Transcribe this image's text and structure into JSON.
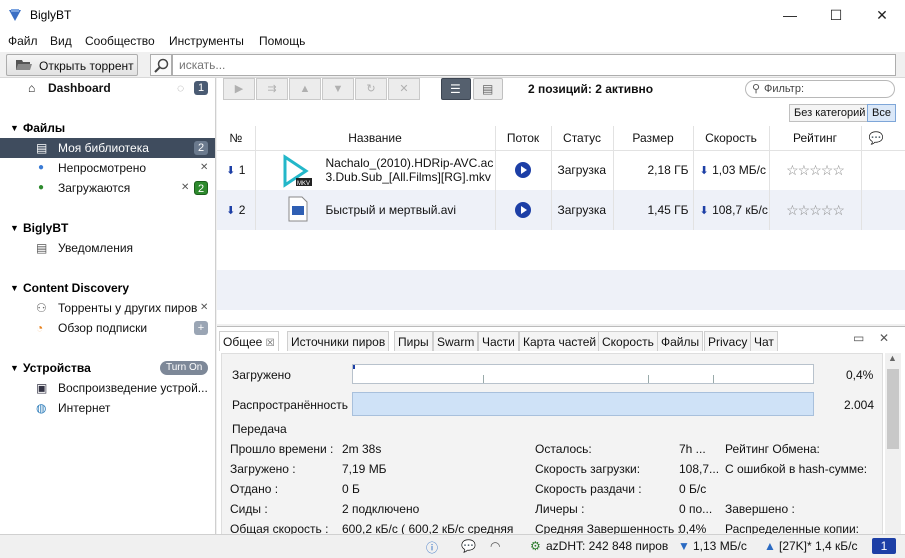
{
  "window": {
    "title": "BiglyBT",
    "minimize": "—",
    "maximize": "☐",
    "close": "✕"
  },
  "menu": [
    "Файл",
    "Вид",
    "Сообщество",
    "Инструменты",
    "Помощь"
  ],
  "toolbar": {
    "open_label": "Открыть торрент",
    "search_placeholder": "искать..."
  },
  "sidebar": {
    "dashboard": {
      "label": "Dashboard",
      "count": "1"
    },
    "files": {
      "header": "Файлы",
      "items": [
        {
          "label": "Моя библиотека",
          "count": "2"
        },
        {
          "label": "Непросмотрено"
        },
        {
          "label": "Загружаются",
          "count": "2"
        }
      ]
    },
    "biglybt": {
      "header": "BiglyBT",
      "items": [
        {
          "label": "Уведомления"
        }
      ]
    },
    "content_discovery": {
      "header": "Content Discovery",
      "items": [
        {
          "label": "Торренты у других пиров"
        },
        {
          "label": "Обзор подписки"
        }
      ]
    },
    "devices": {
      "header": "Устройства",
      "turn_on": "Turn On",
      "items": [
        {
          "label": "Воспроизведение устрой..."
        },
        {
          "label": "Интернет"
        }
      ]
    }
  },
  "list": {
    "summary": "2 позиций: 2 активно",
    "filter_placeholder": "Фильтр:",
    "categories": [
      "Без категорий",
      "Все"
    ],
    "columns": [
      "№",
      "Название",
      "Поток",
      "Статус",
      "Размер",
      "Скорость",
      "Рейтинг"
    ],
    "rows": [
      {
        "num": "1",
        "name": "Nachalo_(2010).HDRip-AVC.ac3.Dub.Sub_[All.Films][RG].mkv",
        "name_line1": "Nachalo_(2010).HDRip-AVC.ac",
        "name_line2": "3.Dub.Sub_[All.Films][RG].mkv",
        "status": "Загрузка",
        "size": "2,18 ГБ",
        "speed": "1,03 МБ/с",
        "icon_badge": "MKV"
      },
      {
        "num": "2",
        "name": "Быстрый и мертвый.avi",
        "status": "Загрузка",
        "size": "1,45 ГБ",
        "speed": "108,7 кБ/с"
      }
    ]
  },
  "detail": {
    "tabs": [
      "Общее",
      "Источники пиров",
      "Пиры",
      "Swarm",
      "Части",
      "Карта частей",
      "Скорость",
      "Файлы",
      "Privacy",
      "Чат"
    ],
    "downloaded_label": "Загружено",
    "downloaded_pct": "0,4%",
    "availability_label": "Распространённость",
    "availability_value": "2.004",
    "transfer_header": "Передача",
    "col1": [
      {
        "label": "Прошло времени :",
        "value": "2m 38s"
      },
      {
        "label": "Загружено :",
        "value": "7,19 МБ"
      },
      {
        "label": "Отдано :",
        "value": "0 Б"
      },
      {
        "label": "Сиды :",
        "value": "2 подключено"
      },
      {
        "label": "Общая скорость :",
        "value": "600,2 кБ/с ( 600,2 кБ/с средняя"
      }
    ],
    "col2": [
      {
        "label": "Осталось:",
        "value": "7h ..."
      },
      {
        "label": "Скорость загрузки:",
        "value": "108,7..."
      },
      {
        "label": "Скорость раздачи :",
        "value": "0 Б/с"
      },
      {
        "label": "Личеры :",
        "value": "0 по..."
      },
      {
        "label": "Средняя Завершенность :",
        "value": "0,4%"
      }
    ],
    "col3": [
      {
        "label": "Рейтинг Обмена:"
      },
      {
        "label": "С ошибкой в hash-сумме:"
      },
      {
        "label": ""
      },
      {
        "label": "Завершено :"
      },
      {
        "label": "Распределенные копии:"
      }
    ]
  },
  "status": {
    "dht": "azDHT: 242 848 пиров",
    "down": "1,13 МБ/с",
    "up": "[27K]* 1,4 кБ/с",
    "count": "1"
  },
  "colors": {
    "sidebar_selected": "#3f4c5e",
    "accent": "#1d3fa6",
    "badge_green": "#2d8a2d"
  }
}
